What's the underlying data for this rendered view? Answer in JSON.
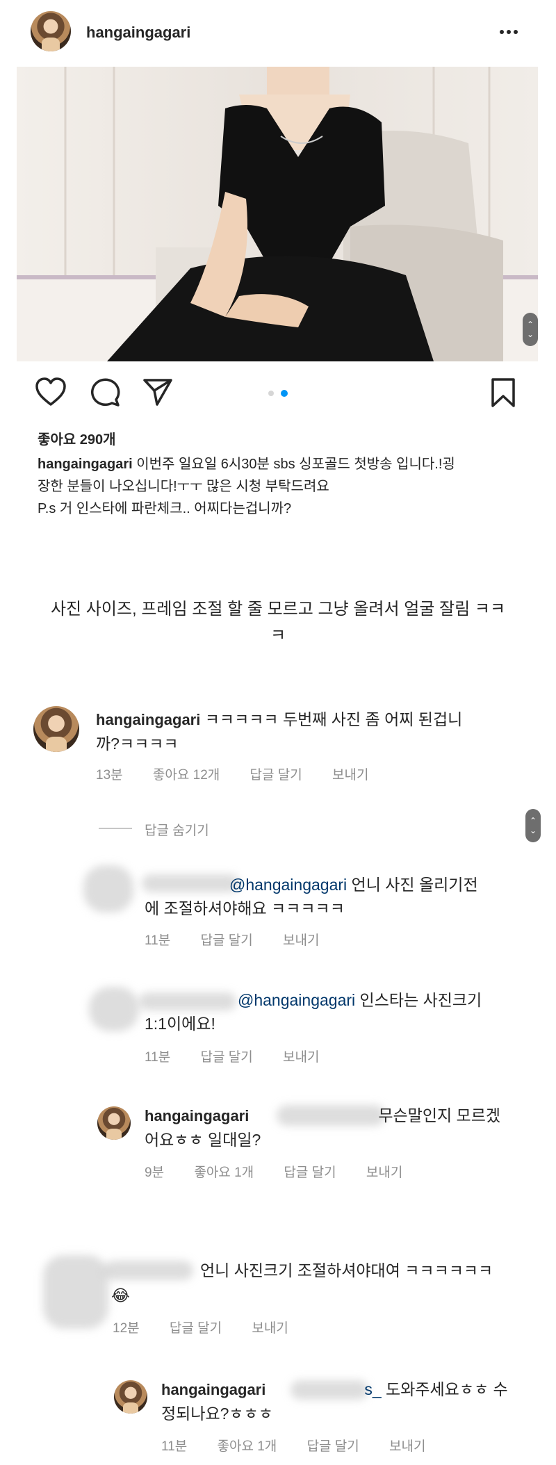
{
  "post": {
    "username": "hangaingagari",
    "more_icon": "more-horizontal-icon",
    "likes_text": "좋아요 290개",
    "caption_username": "hangaingagari",
    "caption_line1": " 이번주 일요일 6시30분 sbs 싱포골드 첫방송 입니다.!굉",
    "caption_line2": "장한 분들이 나오십니다!ㅜㅜ 많은 시청 부탁드려요",
    "caption_line3": "P.s  거 인스타에 파란체크.. 어찌다는겁니까?"
  },
  "overlay_note": {
    "line1": "사진 사이즈, 프레임 조절 할 줄 모르고 그냥 올려서 얼굴 잘림 ㅋㅋ",
    "line2": "ㅋ"
  },
  "comments": [
    {
      "username": "hangaingagari",
      "text_line1": " ㅋㅋㅋㅋㅋ 두번째 사진 좀 어찌 된겁니",
      "text_line2": "까?ㅋㅋㅋㅋ",
      "time": "13분",
      "likes": "좋아요 12개",
      "reply": "답글 달기",
      "send": "보내기"
    }
  ],
  "hide_replies_label": "답글 숨기기",
  "replies": [
    {
      "mention": "@hangaingagari",
      "text_line1": " 언니 사진 올리기전",
      "text_line2": "에 조절하셔야해요 ㅋㅋㅋㅋㅋ",
      "time": "11분",
      "reply": "답글 달기",
      "send": "보내기"
    },
    {
      "mention": "@hangaingagari",
      "text_line1": " 인스타는 사진크기",
      "text_line2": "1:1이에요!",
      "time": "11분",
      "reply": "답글 달기",
      "send": "보내기"
    },
    {
      "username": "hangaingagari",
      "text_line1": "무슨말인지 모르겠",
      "text_line2": "어요ㅎㅎ 일대일?",
      "time": "9분",
      "likes": "좋아요 1개",
      "reply": "답글 달기",
      "send": "보내기"
    }
  ],
  "comment2": {
    "text_line1": "언니 사진크기 조절하셔야대여 ㅋㅋㅋㅋㅋㅋ",
    "text_line2": "😂",
    "time": "12분",
    "reply": "답글 달기",
    "send": "보내기"
  },
  "reply_last": {
    "username": "hangaingagari",
    "partial": "s_",
    "text_line1": " 도와주세요ㅎㅎ 수",
    "text_line2": "정되나요?ㅎㅎㅎ",
    "time": "11분",
    "likes": "좋아요 1개",
    "reply": "답글 달기",
    "send": "보내기"
  },
  "colors": {
    "text": "#262626",
    "meta": "#8e8e8e",
    "mention": "#00376b",
    "carousel_active": "#0095f6"
  }
}
